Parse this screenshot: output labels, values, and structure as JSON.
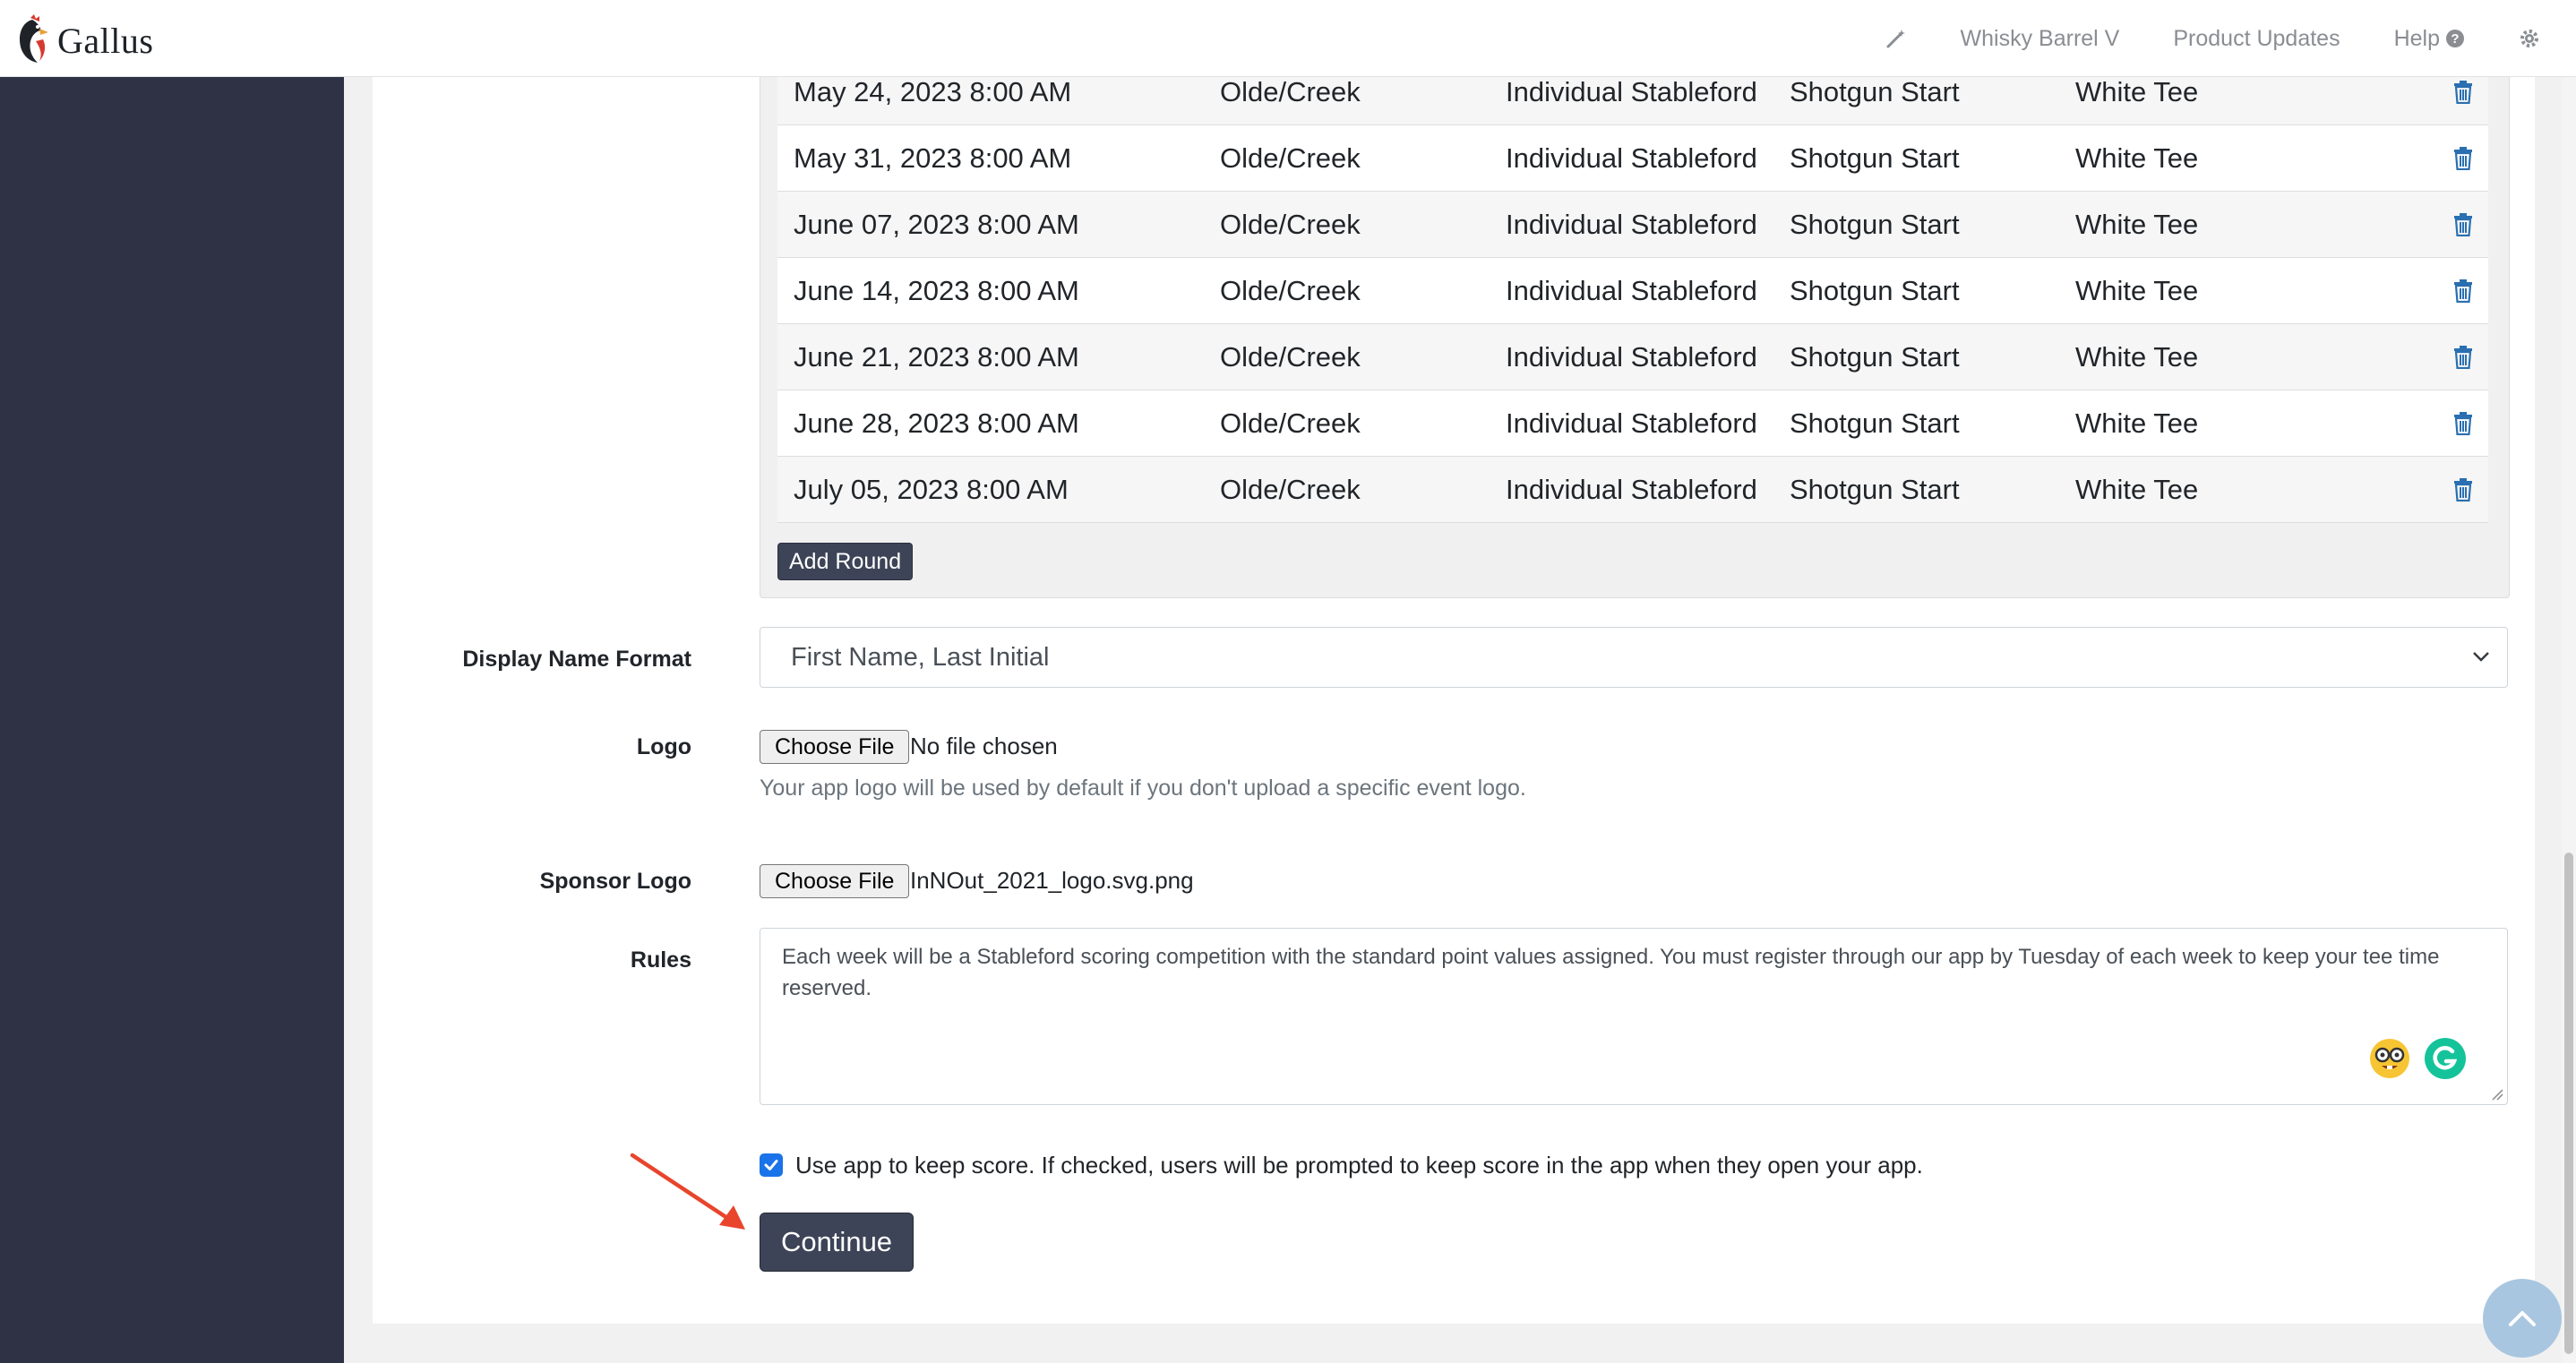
{
  "app": {
    "name": "Gallus"
  },
  "topnav": {
    "event_name": "Whisky Barrel V",
    "product_updates": "Product Updates",
    "help": "Help"
  },
  "rounds": [
    {
      "date": "May 24, 2023 8:00 AM",
      "course": "Olde/Creek",
      "format": "Individual Stableford",
      "start": "Shotgun Start",
      "tee": "White Tee"
    },
    {
      "date": "May 31, 2023 8:00 AM",
      "course": "Olde/Creek",
      "format": "Individual Stableford",
      "start": "Shotgun Start",
      "tee": "White Tee"
    },
    {
      "date": "June 07, 2023 8:00 AM",
      "course": "Olde/Creek",
      "format": "Individual Stableford",
      "start": "Shotgun Start",
      "tee": "White Tee"
    },
    {
      "date": "June 14, 2023 8:00 AM",
      "course": "Olde/Creek",
      "format": "Individual Stableford",
      "start": "Shotgun Start",
      "tee": "White Tee"
    },
    {
      "date": "June 21, 2023 8:00 AM",
      "course": "Olde/Creek",
      "format": "Individual Stableford",
      "start": "Shotgun Start",
      "tee": "White Tee"
    },
    {
      "date": "June 28, 2023 8:00 AM",
      "course": "Olde/Creek",
      "format": "Individual Stableford",
      "start": "Shotgun Start",
      "tee": "White Tee"
    },
    {
      "date": "July 05, 2023 8:00 AM",
      "course": "Olde/Creek",
      "format": "Individual Stableford",
      "start": "Shotgun Start",
      "tee": "White Tee"
    }
  ],
  "add_round_label": "Add Round",
  "form": {
    "display_name": {
      "label": "Display Name Format",
      "value": "First Name, Last Initial"
    },
    "logo": {
      "label": "Logo",
      "button": "Choose File",
      "file": "No file chosen",
      "help": "Your app logo will be used by default if you don't upload a specific event logo."
    },
    "sponsor_logo": {
      "label": "Sponsor Logo",
      "button": "Choose File",
      "file": "InNOut_2021_logo.svg.png"
    },
    "rules": {
      "label": "Rules",
      "value": "Each week will be a Stableford scoring competition with the standard point values assigned. You must register through our app by Tuesday of each week to keep your tee time reserved."
    },
    "keep_score": {
      "checked": true,
      "label": "Use app to keep score. If checked, users will be prompted to keep score in the app when they open your app."
    },
    "continue_label": "Continue"
  },
  "colors": {
    "sidebar": "#2f3245",
    "primary_button": "#3d4457",
    "trash_icon": "#2a6fb0",
    "annotation_arrow": "#e8452c",
    "checkbox": "#1a73e8"
  },
  "icons": [
    "logo-rooster-icon",
    "magic-wand-icon",
    "question-circle-icon",
    "gear-icon",
    "trash-icon",
    "chevron-down-icon",
    "emoji-nerd-icon",
    "grammarly-icon",
    "arrow-up-icon",
    "red-annotation-arrow"
  ]
}
